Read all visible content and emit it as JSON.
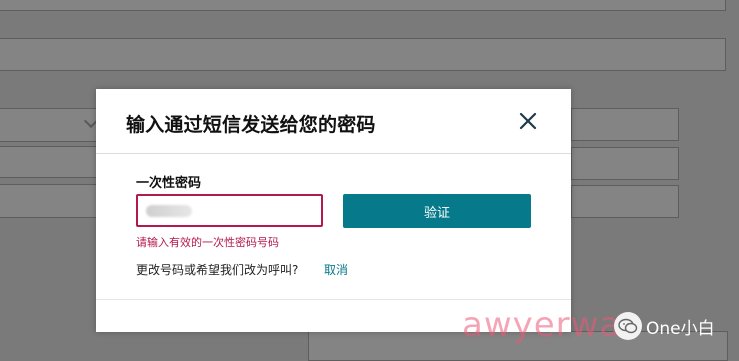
{
  "modal": {
    "title": "输入通过短信发送给您的密码",
    "otp_label": "一次性密码",
    "otp_value": "",
    "verify_label": "验证",
    "error_message": "请输入有效的一次性密码号码",
    "change_prompt": "更改号码或希望我们改为呼叫?",
    "cancel_label": "取消"
  },
  "watermark": {
    "site_text": "awyerwa",
    "brand_name": "One小白",
    "icons": [
      "wechat-logo-icon"
    ]
  },
  "colors": {
    "accent": "#067a8a",
    "error": "#b3194a",
    "overlay": "#7a7a7a"
  }
}
